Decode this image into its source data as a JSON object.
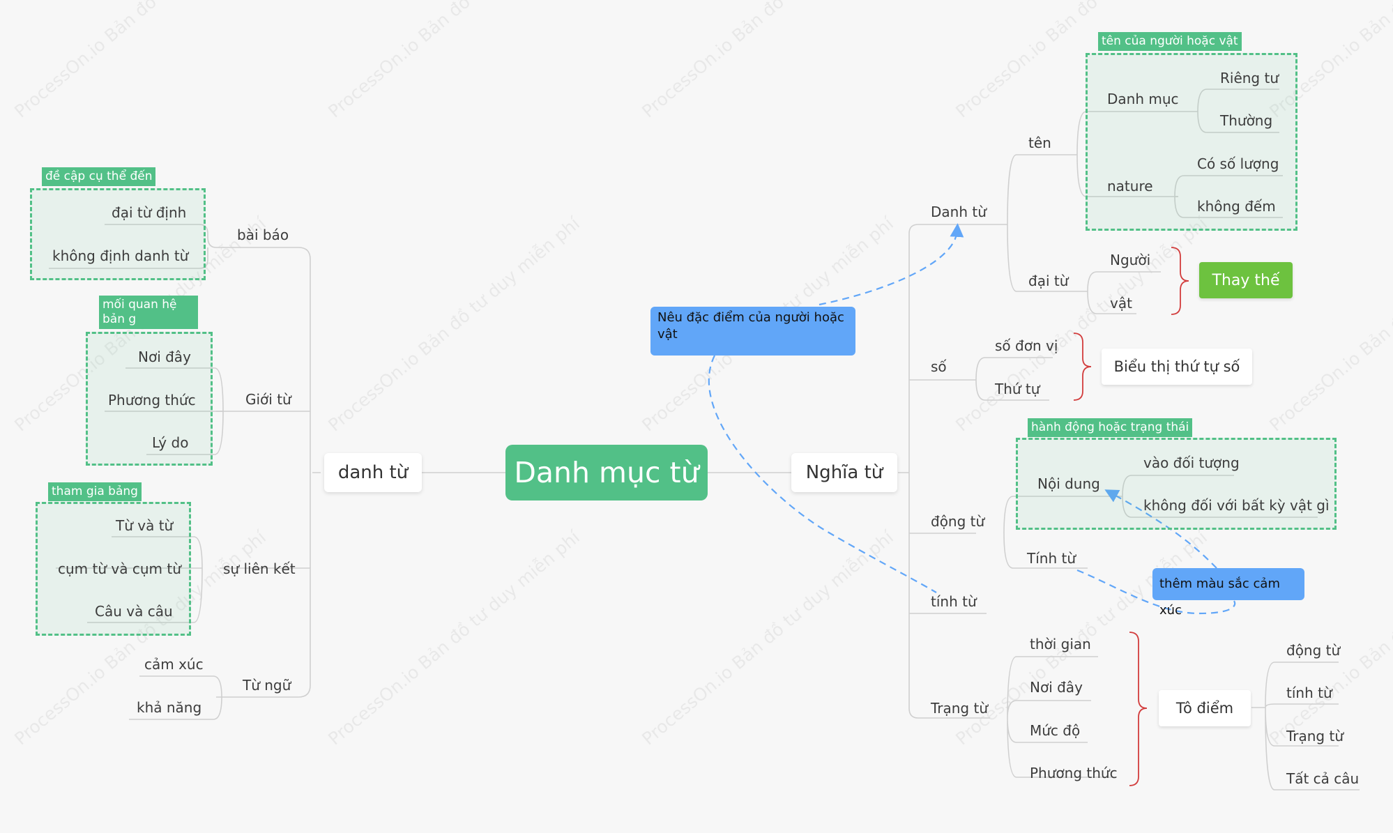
{
  "colors": {
    "background": "#f7f7f7",
    "accent_green": "#52c087",
    "callout_blue": "#61a6f8",
    "brace_red": "#d23c3c",
    "highlight_green": "#6dc23f"
  },
  "watermark": "ProcessOn.io Bản đồ tư duy miễn phí",
  "root": "Danh mục từ",
  "left": {
    "title": "danh từ",
    "article": {
      "label": "bài báo",
      "box_label": "đề cập cụ thể đến",
      "items": [
        "đại từ định",
        "không định danh từ"
      ]
    },
    "preposition": {
      "label": "Giới từ",
      "box_label": "mối quan hệ bản g",
      "items": [
        "Nơi đây",
        "Phương thức",
        "Lý do"
      ]
    },
    "conjunction": {
      "label": "sự liên kết",
      "box_label": "tham gia bảng",
      "items": [
        "Từ và từ",
        "cụm từ và cụm từ",
        "Câu và câu"
      ]
    },
    "interjection": {
      "label": "Từ ngữ",
      "items": [
        "cảm xúc",
        "khả năng"
      ]
    }
  },
  "right": {
    "title": "Nghĩa từ",
    "noun": {
      "label": "Danh từ",
      "name": {
        "label": "tên",
        "box_label": "tên của người hoặc vật",
        "category": {
          "label": "Danh mục",
          "items": [
            "Riêng tư",
            "Thường"
          ]
        },
        "nature": {
          "label": "nature",
          "items": [
            "Có số lượng",
            "không đếm"
          ]
        }
      },
      "pronoun": {
        "label": "đại từ",
        "items": [
          "Người",
          "vật"
        ],
        "summary": "Thay thế"
      }
    },
    "number": {
      "label": "số",
      "items": [
        "số đơn vị",
        "Thứ tự"
      ],
      "summary": "Biểu thị thứ tự số"
    },
    "verb": {
      "label": "động từ",
      "content": {
        "label": "Nội dung",
        "box_label": "hành động hoặc trạng thái",
        "items": [
          "vào đối tượng",
          "không đối với bất kỳ vật gì"
        ]
      },
      "adj": "Tính từ"
    },
    "adjective": {
      "label": "tính từ"
    },
    "adverb": {
      "label": "Trạng từ",
      "items": [
        "thời gian",
        "Nơi đây",
        "Mức độ",
        "Phương thức"
      ],
      "summary": "Tô điểm",
      "summary_items": [
        "động từ",
        "tính từ",
        "Trạng từ",
        "Tất cả câu"
      ]
    }
  },
  "callouts": {
    "describe": "Nêu đặc điểm của người hoặc vật",
    "color_emotion": "thêm màu sắc cảm xúc"
  }
}
